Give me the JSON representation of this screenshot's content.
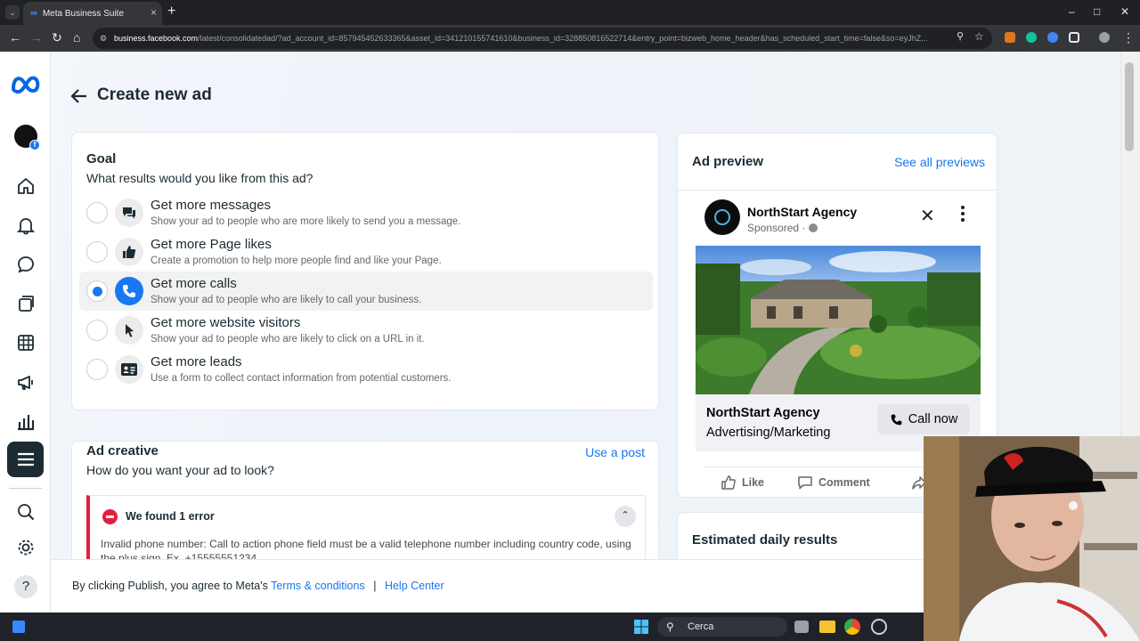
{
  "browser": {
    "tab_title": "Meta Business Suite",
    "url_host": "business.facebook.com",
    "url_path": "/latest/consolidatedad/?ad_account_id=857945452633365&asset_id=341210155741610&business_id=328850816522714&entry_point=bizweb_home_header&has_scheduled_start_time=false&so=eyJhZ..."
  },
  "page": {
    "title": "Create new ad"
  },
  "goal": {
    "title": "Goal",
    "subtitle": "What results would you like from this ad?",
    "options": [
      {
        "label": "Get more messages",
        "desc": "Show your ad to people who are more likely to send you a message.",
        "icon": "message-icon",
        "selected": false
      },
      {
        "label": "Get more Page likes",
        "desc": "Create a promotion to help more people find and like your Page.",
        "icon": "thumbs-up-icon",
        "selected": false
      },
      {
        "label": "Get more calls",
        "desc": "Show your ad to people who are likely to call your business.",
        "icon": "phone-icon",
        "selected": true
      },
      {
        "label": "Get more website visitors",
        "desc": "Show your ad to people who are likely to click on a URL in it.",
        "icon": "cursor-icon",
        "selected": false
      },
      {
        "label": "Get more leads",
        "desc": "Use a form to collect contact information from potential customers.",
        "icon": "contact-card-icon",
        "selected": false
      }
    ]
  },
  "ad_creative": {
    "title": "Ad creative",
    "subtitle": "How do you want your ad to look?",
    "use_post_link": "Use a post",
    "error": {
      "title": "We found 1 error",
      "message": "Invalid phone number: Call to action phone field must be a valid telephone number including country code, using the plus sign. Ex. +15555551234"
    }
  },
  "ad_preview": {
    "title": "Ad preview",
    "see_all_link": "See all previews",
    "page_name": "NorthStart Agency",
    "sponsored": "Sponsored ·",
    "cta_name": "NorthStart Agency",
    "cta_category": "Advertising/Marketing",
    "cta_button": "Call now",
    "actions": {
      "like": "Like",
      "comment": "Comment"
    }
  },
  "estimated": {
    "title": "Estimated daily results"
  },
  "footer": {
    "prefix": "By clicking Publish, you agree to Meta's",
    "terms_link": "Terms & conditions",
    "separator": "|",
    "help_link": "Help Center"
  },
  "taskbar": {
    "search_placeholder": "Cerca"
  },
  "colors": {
    "accent": "#1877f2",
    "error": "#e41e3f",
    "sidebar_active": "#1c2b33"
  }
}
